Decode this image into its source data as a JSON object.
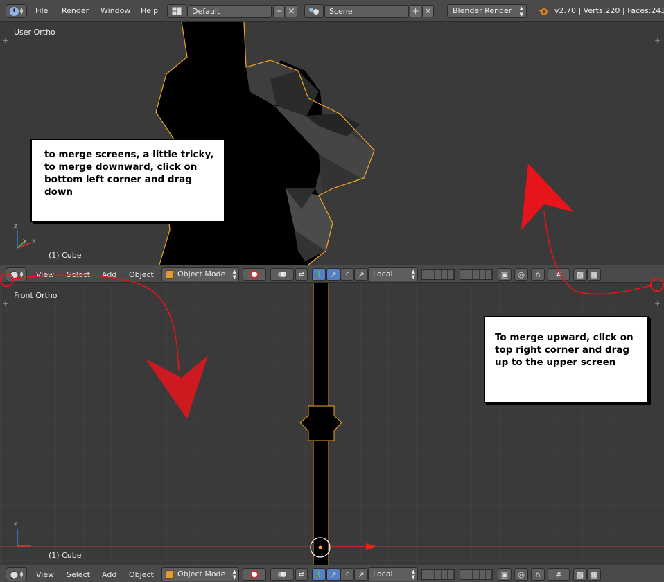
{
  "info_header": {
    "menu": [
      "File",
      "Render",
      "Window",
      "Help"
    ],
    "screen_layout": "Default",
    "scene": "Scene",
    "render_engine": "Blender Render",
    "stats": "v2.70 | Verts:220 | Faces:243 |"
  },
  "top_view": {
    "title": "User Ortho",
    "object_label": "(1) Cube",
    "axes": {
      "x": "x",
      "y": "y",
      "z": "z"
    }
  },
  "bottom_view": {
    "title": "Front Ortho",
    "object_label": "(1) Cube",
    "axes": {
      "z": "z"
    }
  },
  "view_header": {
    "menu": [
      "View",
      "Select",
      "Add",
      "Object"
    ],
    "mode": "Object Mode",
    "orientation": "Local"
  },
  "annotations": {
    "left": "to merge screens, a little tricky, to merge downward, click on bottom left corner and drag down",
    "right": "To merge upward, click on top right corner and drag up to the upper screen"
  },
  "colors": {
    "header_bg": "#4a4a4a",
    "viewport_bg": "#3a3a3a",
    "selection_outline": "#f5a623",
    "annotation_red": "#e8141c"
  }
}
